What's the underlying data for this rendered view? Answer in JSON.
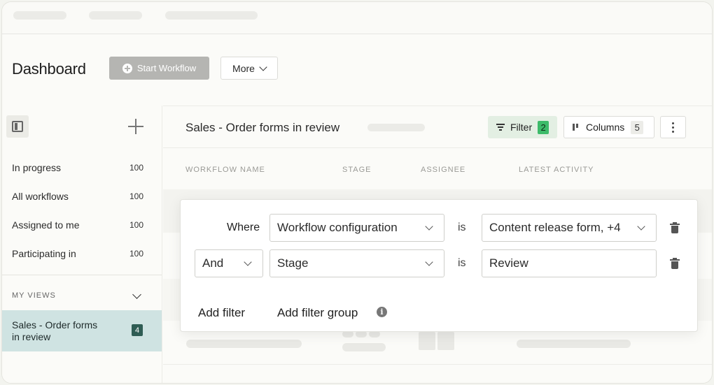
{
  "header": {
    "title": "Dashboard",
    "start_workflow_label": "Start Workflow",
    "more_label": "More"
  },
  "sidebar": {
    "items": [
      {
        "label": "In progress",
        "count": "100"
      },
      {
        "label": "All workflows",
        "count": "100"
      },
      {
        "label": "Assigned to me",
        "count": "100"
      },
      {
        "label": "Participating in",
        "count": "100"
      }
    ],
    "my_views_label": "MY VIEWS",
    "active_view": {
      "label": "Sales - Order forms in review",
      "count": "4"
    }
  },
  "main": {
    "view_title": "Sales - Order forms in review",
    "filter_label": "Filter",
    "filter_count": "2",
    "columns_label": "Columns",
    "columns_count": "5",
    "columns": [
      "WORKFLOW NAME",
      "STAGE",
      "ASSIGNEE",
      "LATEST ACTIVITY"
    ]
  },
  "filter_popover": {
    "rows": [
      {
        "conjunction": "Where",
        "field": "Workflow configuration",
        "operator": "is",
        "value": "Content release form, +4"
      },
      {
        "conjunction": "And",
        "field": "Stage",
        "operator": "is",
        "value": "Review"
      }
    ],
    "add_filter_label": "Add filter",
    "add_filter_group_label": "Add filter group",
    "info_glyph": "i"
  },
  "colors": {
    "accent_green": "#3dbb6a",
    "active_view_bg": "#cfe3e2",
    "filter_button_bg": "#e3efe3"
  }
}
